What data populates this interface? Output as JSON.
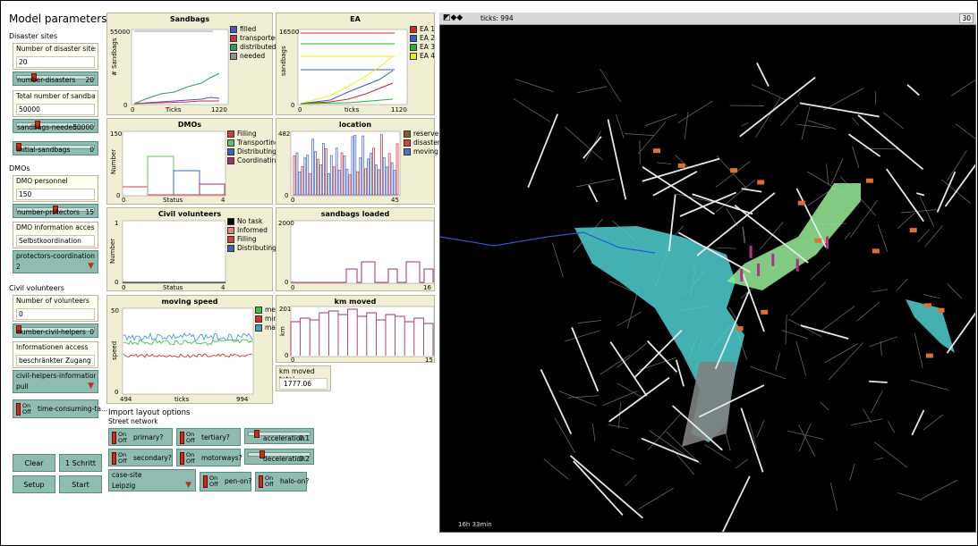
{
  "sidebar": {
    "model_parameters": "Model parameters",
    "disaster_sites": "Disaster sites",
    "dmos": "DMOs",
    "civil_volunteers": "Civil volunteers"
  },
  "inputs": {
    "num_disaster_sites": {
      "label": "Number of disaster sites",
      "value": "20"
    },
    "total_sandbags": {
      "label": "Total number of sandbags nee",
      "value": "50000"
    },
    "dmo_personnel": {
      "label": "DMO personnel",
      "value": "150"
    },
    "dmo_info_access": {
      "label": "DMO information acces",
      "value": "Selbstkoordination"
    },
    "num_volunteers": {
      "label": "Number of volunteers",
      "value": "0"
    },
    "info_access": {
      "label": "Informationen access",
      "value": "beschränkter Zugang"
    }
  },
  "sliders": {
    "number_disasters": {
      "name": "number-disasters",
      "value": "20",
      "level": 0.2
    },
    "sandbags_needed": {
      "name": "sandbags-needed...",
      "value": "50000",
      "level": 0.25
    },
    "initial_sandbags": {
      "name": "initial-sandbags",
      "value": "0",
      "level": 0.0
    },
    "number_protectors": {
      "name": "number-protectors",
      "value": "15",
      "level": 0.45
    },
    "number_civil_helpers": {
      "name": "number-civil-helpers",
      "value": "0",
      "level": 0.0
    },
    "acceleration": {
      "name": "acceleration",
      "value": "0.1",
      "level": 0.1
    },
    "deceleration": {
      "name": "deceleration",
      "value": "0.2",
      "level": 0.2
    }
  },
  "choosers": {
    "protectors_coordination": {
      "name": "protectors-coordination",
      "value": "2"
    },
    "civil_helpers_info": {
      "name": "civil-helpers-information-ac...",
      "value": "pull"
    },
    "case_site": {
      "name": "case-site",
      "value": "Leipzig"
    }
  },
  "switches": {
    "on": "On",
    "off": "Off",
    "time_consuming": "time-consuming-ta...",
    "primary": "primary?",
    "tertiary": "tertiary?",
    "secondary": "secondary?",
    "motorways": "motorways?",
    "pen_on": "pen-on?",
    "halo_on": "halo-on?"
  },
  "buttons": {
    "clear": "Clear",
    "schritt": "1 Schritt",
    "setup": "Setup",
    "start": "Start"
  },
  "import_layout": {
    "title": "Import layout options",
    "street_network": "Street network"
  },
  "monitor": {
    "label": "km moved total",
    "value": "1777.06"
  },
  "view": {
    "ticks_label": "ticks: 994",
    "time_label": "16h 33min",
    "corner": "30"
  },
  "plots": {
    "sandbags": {
      "title": "Sandbags",
      "ylabel": "# Sandbags",
      "xlabel": "Ticks",
      "ymax": "55000",
      "ymin": "0",
      "xmin": "0",
      "xmax": "1220",
      "legend": [
        {
          "name": "filled",
          "color": "#5050c8"
        },
        {
          "name": "transported",
          "color": "#c83246"
        },
        {
          "name": "distributed",
          "color": "#2e9b63"
        },
        {
          "name": "needed",
          "color": "#909090"
        }
      ]
    },
    "ea": {
      "title": "EA",
      "ylabel": "sandbags",
      "xlabel": "ticks",
      "ymax": "16500",
      "ymin": "0",
      "xmin": "0",
      "xmax": "1120",
      "legend": [
        {
          "name": "EA 1",
          "color": "#d02828"
        },
        {
          "name": "EA 2",
          "color": "#3c5ad2"
        },
        {
          "name": "EA 3",
          "color": "#28b428"
        },
        {
          "name": "EA 4",
          "color": "#f0f000"
        }
      ]
    },
    "dmos": {
      "title": "DMOs",
      "ylabel": "Number",
      "xlabel": "Status",
      "ymax": "150",
      "ymin": "0",
      "xmin": "0",
      "xmax": "4",
      "legend": [
        {
          "name": "Filling",
          "color": "#d04040"
        },
        {
          "name": "Transporting",
          "color": "#60c060"
        },
        {
          "name": "Distributing",
          "color": "#4060c0"
        },
        {
          "name": "Coordinating",
          "color": "#a03070"
        }
      ]
    },
    "location": {
      "title": "location",
      "ymax": "482",
      "ymin": "0",
      "xmin": "0",
      "xmax": "45",
      "legend": [
        {
          "name": "reserve",
          "color": "#8b5a2b"
        },
        {
          "name": "disaster",
          "color": "#d04040"
        },
        {
          "name": "moving",
          "color": "#5070d0"
        }
      ]
    },
    "civil": {
      "title": "Civil volunteers",
      "ylabel": "Number",
      "xlabel": "Status",
      "ymax": "1",
      "ymin": "0",
      "xmin": "0",
      "xmax": "4",
      "legend": [
        {
          "name": "No task",
          "color": "#000000"
        },
        {
          "name": "Informed",
          "color": "#f08080"
        },
        {
          "name": "Filling",
          "color": "#d04040"
        },
        {
          "name": "Distributing",
          "color": "#4060c0"
        }
      ]
    },
    "loaded": {
      "title": "sandbags loaded",
      "ymax": "2000",
      "ymin": "0",
      "xmin": "0",
      "xmax": "16"
    },
    "speed": {
      "title": "moving speed",
      "ylabel": "speed",
      "xlabel": "ticks",
      "ymax": "50",
      "ymin": "0",
      "xmin": "494",
      "xmax": "994",
      "legend": [
        {
          "name": "mean",
          "color": "#40c040"
        },
        {
          "name": "min",
          "color": "#d03030"
        },
        {
          "name": "max",
          "color": "#40a0d0"
        }
      ]
    },
    "km": {
      "title": "km moved",
      "ylabel": "km",
      "ymax": "201",
      "ymin": "0",
      "xmin": "0",
      "xmax": "15"
    }
  }
}
